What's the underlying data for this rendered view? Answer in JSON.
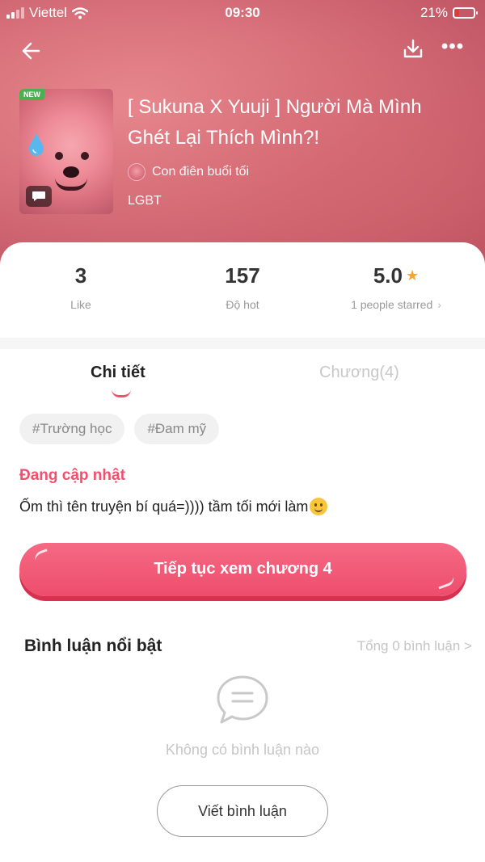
{
  "status_bar": {
    "carrier": "Viettel",
    "time": "09:30",
    "battery": "21%"
  },
  "story": {
    "badge": "NEW",
    "title": "[ Sukuna X Yuuji ] Người Mà Mình Ghét Lại Thích Mình?!",
    "author": "Con điên buổi tối",
    "genre": "LGBT"
  },
  "stats": {
    "likes": {
      "value": "3",
      "label": "Like"
    },
    "hot": {
      "value": "157",
      "label": "Độ hot"
    },
    "rating": {
      "value": "5.0",
      "label": "1 people starred"
    }
  },
  "tabs": {
    "details": "Chi tiết",
    "chapters": "Chương(4)"
  },
  "tags": [
    "#Trường học",
    "#Đam mỹ"
  ],
  "status_label": "Đang cập nhật",
  "description": "Ốm thì tên truyện bí quá=)))) tầm tối mới làm",
  "continue_button": "Tiếp tục xem chương 4",
  "comments": {
    "title": "Bình luận nổi bật",
    "total": "Tổng 0 bình luận >",
    "empty": "Không có bình luận nào",
    "write_button": "Viết bình luận"
  },
  "colors": {
    "accent": "#f0506e",
    "button": "#ee4d6c",
    "star": "#f5a623"
  },
  "icons": [
    "back-arrow-icon",
    "download-icon",
    "more-icon",
    "star-icon",
    "chevron-right-icon",
    "comment-bubble-icon",
    "water-drop-icon",
    "smile-emoji-icon"
  ]
}
